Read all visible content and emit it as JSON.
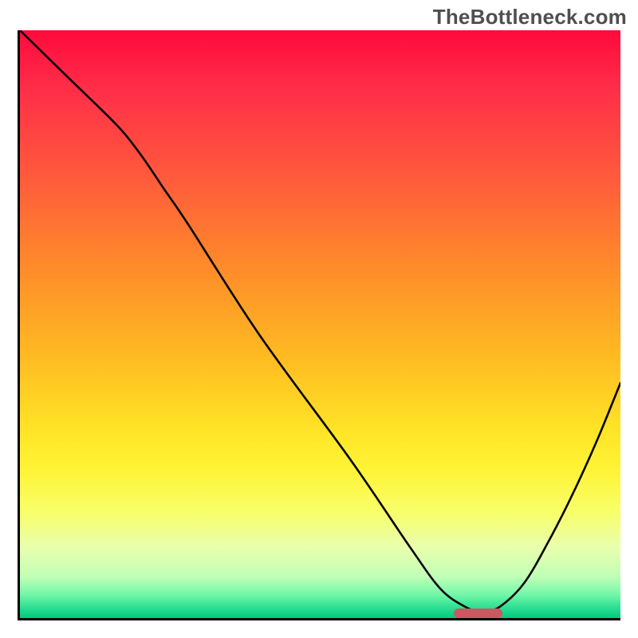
{
  "watermark": "TheBottleneck.com",
  "chart_data": {
    "type": "line",
    "title": "",
    "xlabel": "",
    "ylabel": "",
    "xlim": [
      0,
      100
    ],
    "ylim": [
      0,
      100
    ],
    "series": [
      {
        "name": "curve",
        "x": [
          0,
          8,
          16,
          20,
          24,
          28,
          40,
          55,
          65,
          70,
          74,
          77,
          80,
          84,
          88,
          92,
          96,
          100
        ],
        "values": [
          100,
          92,
          84,
          79,
          73,
          67,
          48,
          27,
          12,
          5,
          2,
          1,
          2,
          6,
          13,
          21,
          30,
          40
        ]
      }
    ],
    "marker": {
      "x_start": 72,
      "x_end": 80,
      "y": 1.2
    },
    "gradient_stops": [
      {
        "pos": 0,
        "color": "#ff0a3c"
      },
      {
        "pos": 10,
        "color": "#ff2e48"
      },
      {
        "pos": 25,
        "color": "#ff5a3c"
      },
      {
        "pos": 40,
        "color": "#ff8a2a"
      },
      {
        "pos": 55,
        "color": "#ffb922"
      },
      {
        "pos": 68,
        "color": "#ffe426"
      },
      {
        "pos": 75,
        "color": "#fff437"
      },
      {
        "pos": 82,
        "color": "#f7ff6a"
      },
      {
        "pos": 88,
        "color": "#e9ffad"
      },
      {
        "pos": 93,
        "color": "#bfffb6"
      },
      {
        "pos": 96,
        "color": "#73f7a8"
      },
      {
        "pos": 98.5,
        "color": "#25db8f"
      },
      {
        "pos": 100,
        "color": "#00c97c"
      }
    ]
  }
}
